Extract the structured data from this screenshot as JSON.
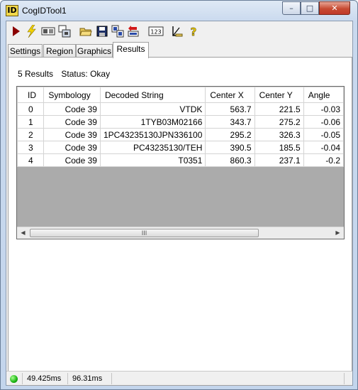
{
  "window": {
    "icon_text": "ID",
    "title": "CogIDTool1",
    "minimize_glyph": "–",
    "maximize_glyph": "□",
    "close_glyph": "✕"
  },
  "toolbar": {
    "items": [
      {
        "name": "run-icon"
      },
      {
        "name": "live-lightning-icon"
      },
      {
        "name": "image-source-icon"
      },
      {
        "name": "image-settings-icon"
      },
      {
        "name": "open-folder-icon"
      },
      {
        "name": "save-icon"
      },
      {
        "name": "copy-region-icon"
      },
      {
        "name": "reset-icon"
      },
      {
        "name": "numeric-display-icon",
        "text": "123"
      },
      {
        "name": "ruler-icon"
      },
      {
        "name": "help-icon",
        "text": "?"
      }
    ]
  },
  "tabs": [
    {
      "label": "Settings",
      "active": false
    },
    {
      "label": "Region",
      "active": false
    },
    {
      "label": "Graphics",
      "active": false
    },
    {
      "label": "Results",
      "active": true
    }
  ],
  "results": {
    "count_text": "5 Results",
    "status_text": "Status: Okay",
    "columns": [
      "ID",
      "Symbology",
      "Decoded String",
      "Center X",
      "Center Y",
      "Angle"
    ],
    "rows": [
      {
        "id": "0",
        "symbology": "Code 39",
        "decoded": "VTDK",
        "cx": "563.7",
        "cy": "221.5",
        "angle": "-0.03"
      },
      {
        "id": "1",
        "symbology": "Code 39",
        "decoded": "1TYB03M02166",
        "cx": "343.7",
        "cy": "275.2",
        "angle": "-0.06"
      },
      {
        "id": "2",
        "symbology": "Code 39",
        "decoded": "1PC43235130JPN336100",
        "cx": "295.2",
        "cy": "326.3",
        "angle": "-0.05"
      },
      {
        "id": "3",
        "symbology": "Code 39",
        "decoded": "PC43235130/TEH",
        "cx": "390.5",
        "cy": "185.5",
        "angle": "-0.04"
      },
      {
        "id": "4",
        "symbology": "Code 39",
        "decoded": "T0351",
        "cx": "860.3",
        "cy": "237.1",
        "angle": "-0.2"
      }
    ],
    "scroll_thumb_grip": "III",
    "scroll_left_glyph": "◀",
    "scroll_right_glyph": "▶"
  },
  "statusbar": {
    "led_color": "#19b312",
    "time_1": "49.425ms",
    "time_2": "96.31ms"
  }
}
